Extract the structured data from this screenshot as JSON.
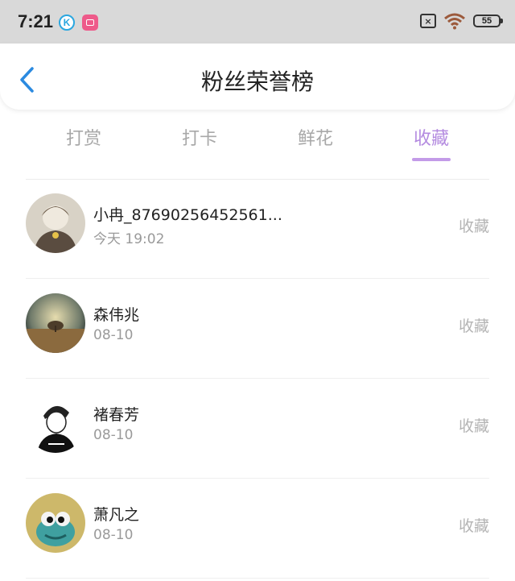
{
  "status_bar": {
    "time": "7:21",
    "k_app_letter": "K",
    "battery": "55",
    "sim_label": "×"
  },
  "header": {
    "title": "粉丝荣誉榜"
  },
  "tabs": [
    {
      "label": "打赏",
      "active": false
    },
    {
      "label": "打卡",
      "active": false
    },
    {
      "label": "鲜花",
      "active": false
    },
    {
      "label": "收藏",
      "active": true
    }
  ],
  "list": [
    {
      "name": "小冉_87690256452561...",
      "time": "今天 19:02",
      "action": "收藏"
    },
    {
      "name": "森伟兆",
      "time": "08-10",
      "action": "收藏"
    },
    {
      "name": "褚春芳",
      "time": "08-10",
      "action": "收藏"
    },
    {
      "name": "萧凡之",
      "time": "08-10",
      "action": "收藏"
    }
  ],
  "colors": {
    "accent": "#b48be0",
    "back_arrow": "#2b8ae0",
    "inactive_tab": "#a8a8a8"
  }
}
